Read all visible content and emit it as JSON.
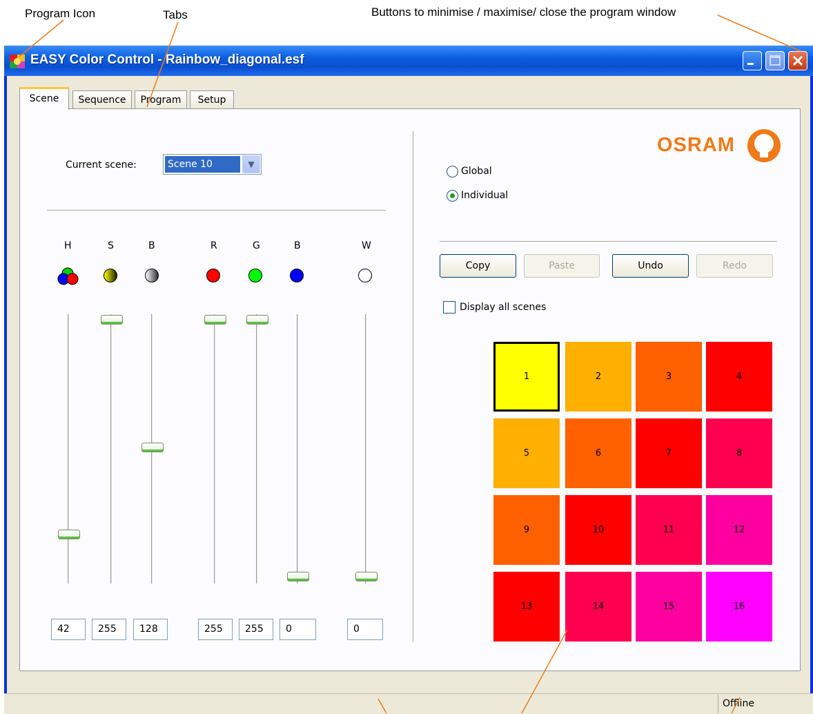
{
  "annotations": {
    "program_icon": "Program Icon",
    "tabs": "Tabs",
    "window_buttons": "Buttons to minimise / maximise/ close the program window"
  },
  "window": {
    "title": "EASY Color Control - Rainbow_diagonal.esf",
    "title_bar_color": "#0a5fe0",
    "icons": [
      "app-icon",
      "minimize-icon",
      "maximize-icon",
      "close-icon"
    ]
  },
  "tabs": [
    {
      "label": "Scene",
      "active": true
    },
    {
      "label": "Sequence",
      "active": false
    },
    {
      "label": "Program",
      "active": false
    },
    {
      "label": "Setup",
      "active": false
    }
  ],
  "scene": {
    "current_scene_label": "Current scene:",
    "current_scene_value": "Scene 10"
  },
  "sliders": [
    {
      "label": "H",
      "icon": "hue-icon",
      "value": "42",
      "level": 0.165
    },
    {
      "label": "S",
      "icon": "saturation-icon",
      "value": "255",
      "level": 1.0
    },
    {
      "label": "B",
      "icon": "brightness-icon",
      "value": "128",
      "level": 0.502
    },
    {
      "label": "R",
      "icon": "red-icon",
      "value": "255",
      "level": 1.0
    },
    {
      "label": "G",
      "icon": "green-icon",
      "value": "255",
      "level": 1.0
    },
    {
      "label": "B",
      "icon": "blue-icon",
      "value": "0",
      "level": 0.0
    },
    {
      "label": "W",
      "icon": "white-icon",
      "value": "0",
      "level": 0.0
    }
  ],
  "mode": {
    "global_label": "Global",
    "individual_label": "Individual",
    "selected": "Individual"
  },
  "buttons": {
    "copy": "Copy",
    "paste": "Paste",
    "undo": "Undo",
    "redo": "Redo"
  },
  "display_all_label": "Display all scenes",
  "logo_text": "OSRAM",
  "scene_grid": [
    {
      "label": "1",
      "color": "#ffff00",
      "selected": true
    },
    {
      "label": "2",
      "color": "#ffaf00"
    },
    {
      "label": "3",
      "color": "#ff6000"
    },
    {
      "label": "4",
      "color": "#ff0000"
    },
    {
      "label": "5",
      "color": "#ffaf00"
    },
    {
      "label": "6",
      "color": "#ff6000"
    },
    {
      "label": "7",
      "color": "#ff0000"
    },
    {
      "label": "8",
      "color": "#ff0050"
    },
    {
      "label": "9",
      "color": "#ff6000"
    },
    {
      "label": "10",
      "color": "#ff0000"
    },
    {
      "label": "11",
      "color": "#ff0050"
    },
    {
      "label": "12",
      "color": "#ff00a0"
    },
    {
      "label": "13",
      "color": "#ff0000"
    },
    {
      "label": "14",
      "color": "#ff0050"
    },
    {
      "label": "15",
      "color": "#ff00a0"
    },
    {
      "label": "16",
      "color": "#ff00ff"
    }
  ],
  "status": {
    "connection": "Offline"
  },
  "colors": {
    "annotation_line": "#ef7a19",
    "osram_orange": "#ef7a19"
  }
}
